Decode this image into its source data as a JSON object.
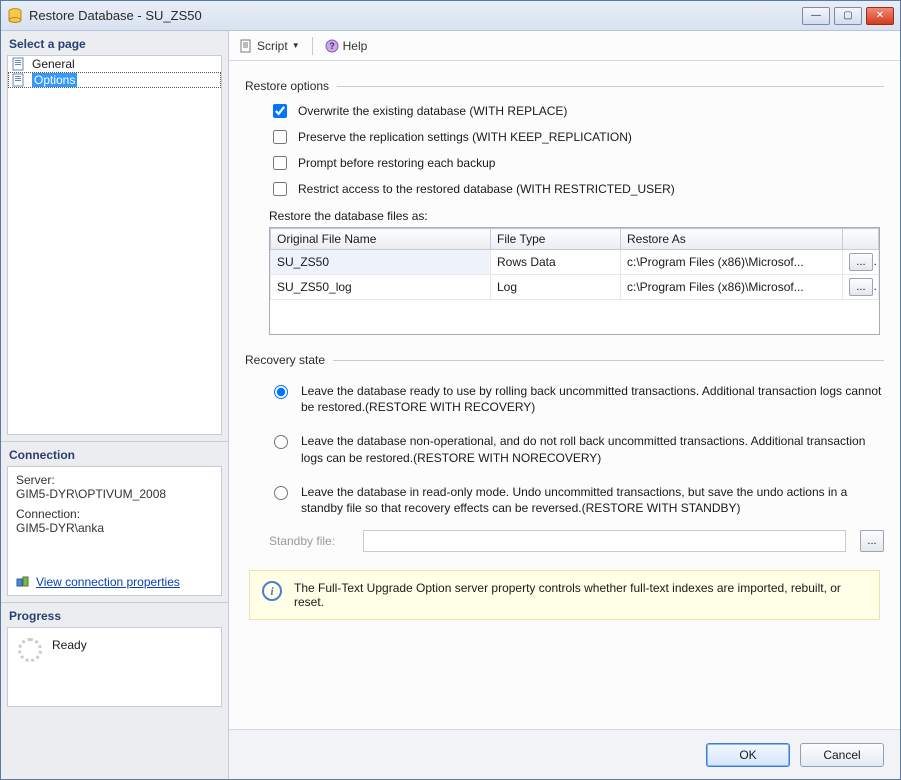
{
  "window": {
    "title": "Restore Database - SU_ZS50"
  },
  "sidebar": {
    "select_page_header": "Select a page",
    "pages": [
      {
        "label": "General",
        "selected": false
      },
      {
        "label": "Options",
        "selected": true
      }
    ],
    "connection_header": "Connection",
    "server_label": "Server:",
    "server_value": "GIM5-DYR\\OPTIVUM_2008",
    "connection_label": "Connection:",
    "connection_value": "GIM5-DYR\\anka",
    "conn_link": "View connection properties",
    "progress_header": "Progress",
    "progress_status": "Ready"
  },
  "toolbar": {
    "script_label": "Script",
    "help_label": "Help"
  },
  "restore": {
    "group_label": "Restore options",
    "opt_overwrite": "Overwrite the existing database (WITH REPLACE)",
    "opt_preserve": "Preserve the replication settings (WITH KEEP_REPLICATION)",
    "opt_prompt": "Prompt before restoring each backup",
    "opt_restrict": "Restrict access to the restored database (WITH RESTRICTED_USER)",
    "files_label": "Restore the database files as:",
    "cols": {
      "c1": "Original File Name",
      "c2": "File Type",
      "c3": "Restore As"
    },
    "rows": [
      {
        "name": "SU_ZS50",
        "type": "Rows Data",
        "path": "c:\\Program Files (x86)\\Microsof..."
      },
      {
        "name": "SU_ZS50_log",
        "type": "Log",
        "path": "c:\\Program Files (x86)\\Microsof..."
      }
    ]
  },
  "recovery": {
    "group_label": "Recovery state",
    "r1": "Leave the database ready to use by rolling back uncommitted transactions. Additional transaction logs cannot be restored.(RESTORE WITH RECOVERY)",
    "r2": "Leave the database non-operational, and do not roll back uncommitted transactions. Additional transaction logs can be restored.(RESTORE WITH NORECOVERY)",
    "r3": "Leave the database in read-only mode. Undo uncommitted transactions, but save the undo actions in a standby file so that recovery effects can be reversed.(RESTORE WITH STANDBY)",
    "standby_label": "Standby file:",
    "standby_value": ""
  },
  "info_text": "The Full-Text Upgrade Option server property controls whether full-text indexes are imported, rebuilt, or reset.",
  "footer": {
    "ok": "OK",
    "cancel": "Cancel"
  }
}
